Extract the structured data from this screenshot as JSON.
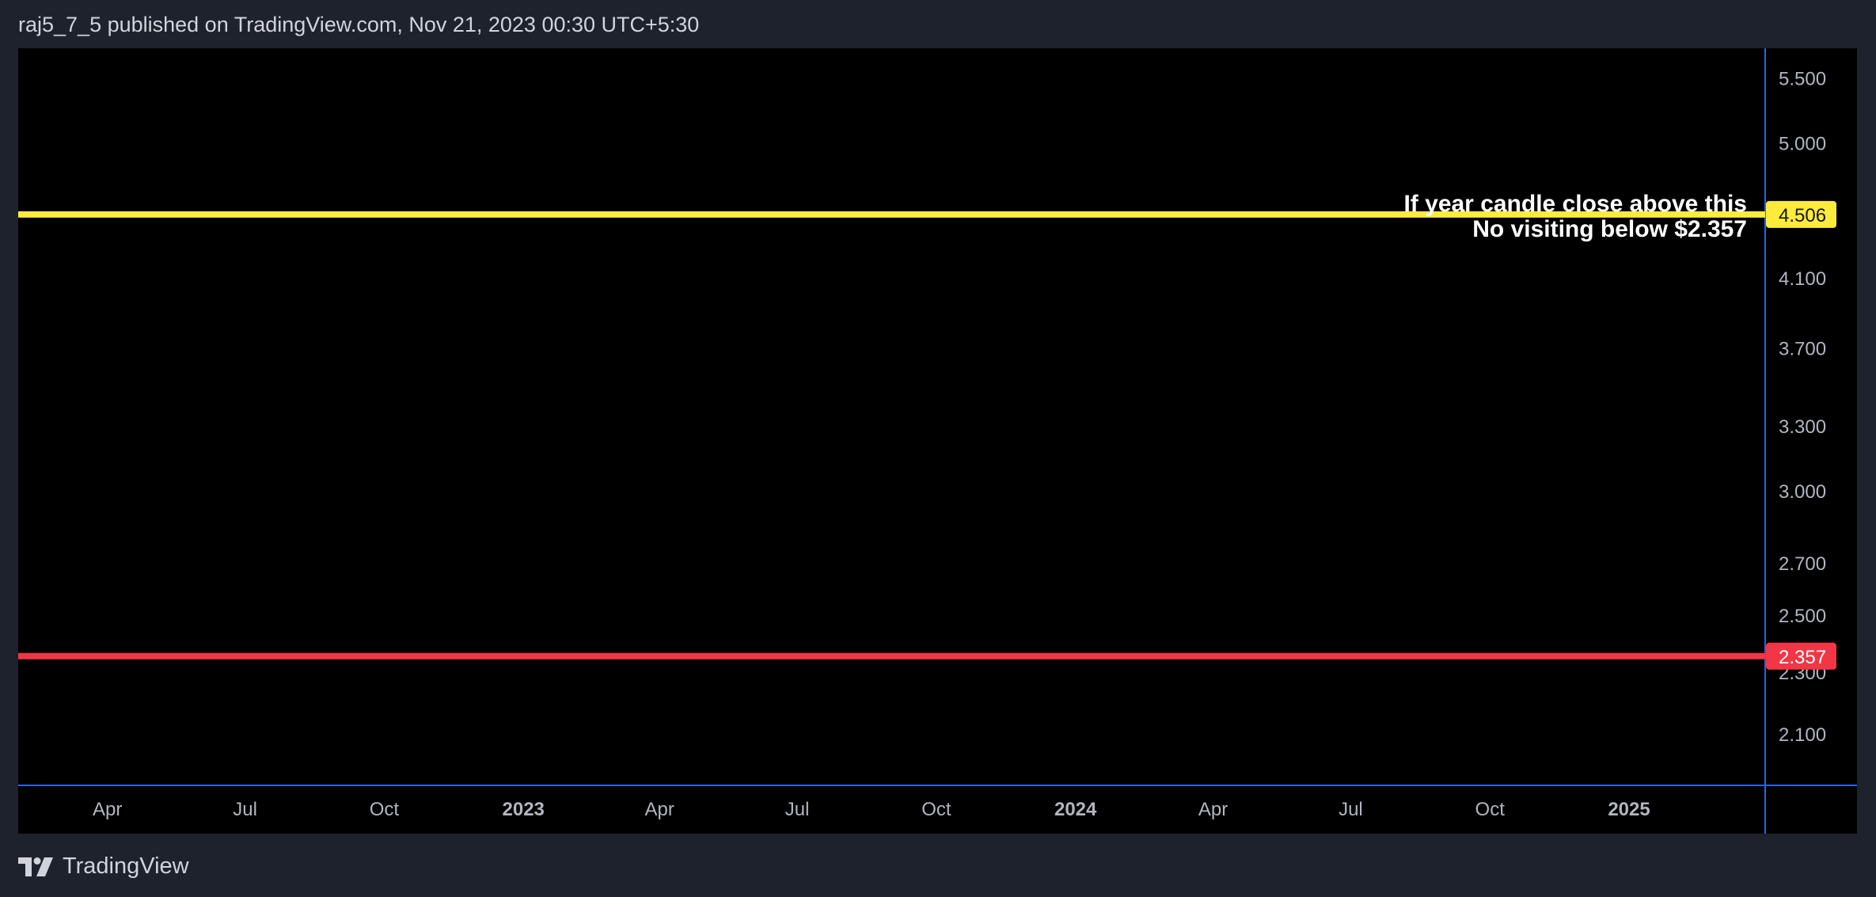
{
  "header": {
    "published_text": "raj5_7_5 published on TradingView.com, Nov 21, 2023 00:30 UTC+5:30"
  },
  "footer": {
    "brand": "TradingView",
    "logo_icon": "tradingview-logo-icon"
  },
  "colors": {
    "page_bg": "#1e222d",
    "chart_bg": "#000000",
    "axis_line": "#2962ff",
    "axis_text": "#b2b5be",
    "resistance": "#ffeb3b",
    "support": "#f23645"
  },
  "chart_data": {
    "type": "line",
    "title": "",
    "xlabel": "",
    "ylabel": "",
    "x_scale": "time",
    "y_scale": "log",
    "grid": false,
    "xlim": [
      "2022-02-01",
      "2025-04-01"
    ],
    "ylim": [
      1.95,
      5.75
    ],
    "x_ticks": [
      {
        "label": "Apr",
        "date": "2022-04-01",
        "major": false
      },
      {
        "label": "Jul",
        "date": "2022-07-01",
        "major": false
      },
      {
        "label": "Oct",
        "date": "2022-10-01",
        "major": false
      },
      {
        "label": "2023",
        "date": "2023-01-01",
        "major": true
      },
      {
        "label": "Apr",
        "date": "2023-04-01",
        "major": false
      },
      {
        "label": "Jul",
        "date": "2023-07-01",
        "major": false
      },
      {
        "label": "Oct",
        "date": "2023-10-01",
        "major": false
      },
      {
        "label": "2024",
        "date": "2024-01-01",
        "major": true
      },
      {
        "label": "Apr",
        "date": "2024-04-01",
        "major": false
      },
      {
        "label": "Jul",
        "date": "2024-07-01",
        "major": false
      },
      {
        "label": "Oct",
        "date": "2024-10-01",
        "major": false
      },
      {
        "label": "2025",
        "date": "2025-01-01",
        "major": true
      }
    ],
    "y_ticks": [
      {
        "label": "5.500",
        "value": 5.5
      },
      {
        "label": "5.000",
        "value": 5.0
      },
      {
        "label": "4.100",
        "value": 4.1
      },
      {
        "label": "3.700",
        "value": 3.7
      },
      {
        "label": "3.300",
        "value": 3.3
      },
      {
        "label": "3.000",
        "value": 3.0
      },
      {
        "label": "2.700",
        "value": 2.7
      },
      {
        "label": "2.500",
        "value": 2.5
      },
      {
        "label": "2.300",
        "value": 2.3
      },
      {
        "label": "2.100",
        "value": 2.1
      }
    ],
    "horizontal_lines": [
      {
        "value": 4.506,
        "label": "4.506",
        "color": "#ffeb3b",
        "label_text_color": "#131722"
      },
      {
        "value": 2.357,
        "label": "2.357",
        "color": "#f23645",
        "label_text_color": "#ffffff"
      }
    ],
    "annotations": [
      {
        "lines": [
          "If year candle close above this",
          "No visiting below $2.357"
        ],
        "anchor_value": 4.506,
        "color": "#ffffff"
      }
    ]
  }
}
